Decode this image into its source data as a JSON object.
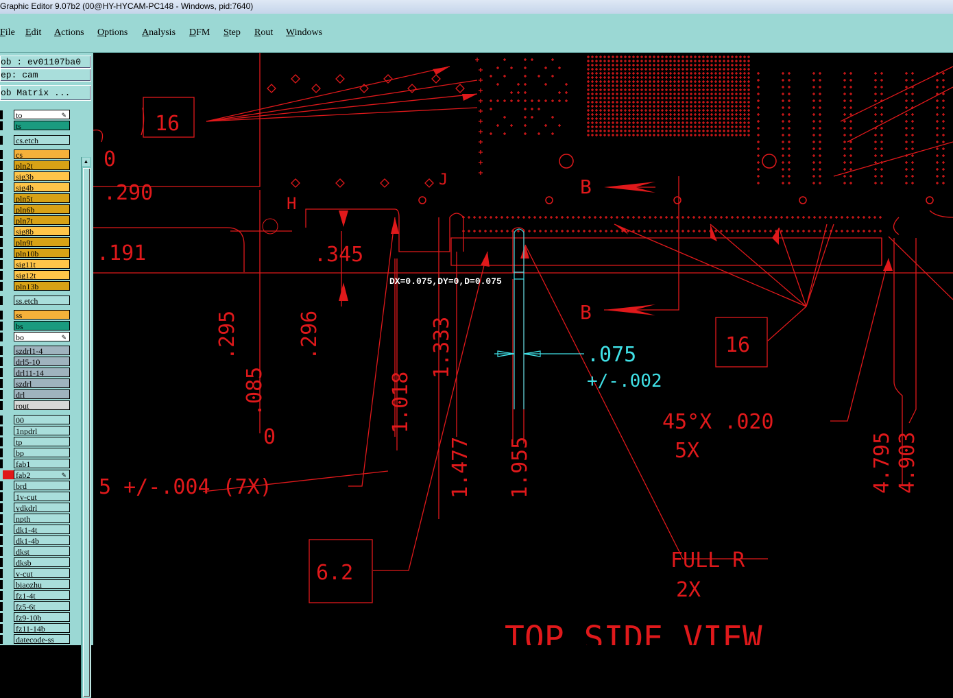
{
  "window": {
    "title": "Graphic Editor 9.07b2 (00@HY-HYCAM-PC148 - Windows, pid:7640)"
  },
  "menu": [
    "File",
    "Edit",
    "Actions",
    "Options",
    "Analysis",
    "DFM",
    "Step",
    "Rout",
    "Windows"
  ],
  "job_info": {
    "job": "ob : ev01107ba0",
    "step": "ep: cam",
    "matrix_button": "ob Matrix ..."
  },
  "layers": [
    {
      "name": "to",
      "color": "#ffffff",
      "edit": true
    },
    {
      "name": "ts",
      "color": "#1a9b7f"
    },
    {
      "name": "cs.etch",
      "color": "#a9dedb"
    },
    {
      "name": "cs",
      "color": "#f5b13a"
    },
    {
      "name": "pln2t",
      "color": "#d8a216"
    },
    {
      "name": "sig3b",
      "color": "#ffc549"
    },
    {
      "name": "sig4b",
      "color": "#ffc549"
    },
    {
      "name": "pln5t",
      "color": "#d8a216"
    },
    {
      "name": "pln6b",
      "color": "#d8a216"
    },
    {
      "name": "pln7t",
      "color": "#d8a216"
    },
    {
      "name": "sig8b",
      "color": "#ffc549"
    },
    {
      "name": "pln9t",
      "color": "#d8a216"
    },
    {
      "name": "pln10b",
      "color": "#d8a216"
    },
    {
      "name": "sig11t",
      "color": "#ffc549"
    },
    {
      "name": "sig12t",
      "color": "#ffc549"
    },
    {
      "name": "pln13b",
      "color": "#d8a216"
    },
    {
      "name": "ss.etch",
      "color": "#a9dedb"
    },
    {
      "name": "ss",
      "color": "#f5b13a"
    },
    {
      "name": "bs",
      "color": "#1a9b7f"
    },
    {
      "name": "bo",
      "color": "#ffffff",
      "edit": true
    },
    {
      "name": "szdrl1-4",
      "color": "#9fb3be"
    },
    {
      "name": "drl5-10",
      "color": "#9fb3be"
    },
    {
      "name": "drl11-14",
      "color": "#9fb3be"
    },
    {
      "name": "szdrl",
      "color": "#9fb3be"
    },
    {
      "name": "drl",
      "color": "#9fb3be"
    },
    {
      "name": "rout",
      "color": "#d7d7d7"
    },
    {
      "name": "00",
      "color": "#a9dedb"
    },
    {
      "name": "1npdrl",
      "color": "#a9dedb"
    },
    {
      "name": "tp",
      "color": "#a9dedb"
    },
    {
      "name": "bp",
      "color": "#a9dedb"
    },
    {
      "name": "fab1",
      "color": "#a9dedb"
    },
    {
      "name": "fab2",
      "color": "#a9dedb",
      "edit": true,
      "active": true
    },
    {
      "name": "brd",
      "color": "#a9dedb"
    },
    {
      "name": "1v-cut",
      "color": "#a9dedb"
    },
    {
      "name": "ydkdrl",
      "color": "#a9dedb"
    },
    {
      "name": "npth",
      "color": "#a9dedb"
    },
    {
      "name": "dk1-4t",
      "color": "#a9dedb"
    },
    {
      "name": "dk1-4b",
      "color": "#a9dedb"
    },
    {
      "name": "dkst",
      "color": "#a9dedb"
    },
    {
      "name": "dksb",
      "color": "#a9dedb"
    },
    {
      "name": "v-cut",
      "color": "#a9dedb"
    },
    {
      "name": "biaozhu",
      "color": "#a9dedb"
    },
    {
      "name": "fz1-4t",
      "color": "#a9dedb"
    },
    {
      "name": "fz5-6t",
      "color": "#a9dedb"
    },
    {
      "name": "fz9-10b",
      "color": "#a9dedb"
    },
    {
      "name": "fz11-14b",
      "color": "#a9dedb"
    },
    {
      "name": "datecode-ss",
      "color": "#a9dedb"
    }
  ],
  "canvas": {
    "measure_readout": "DX=0.075,DY=0,D=0.075",
    "dim_labels": {
      "d290": ".290",
      "d191": ".191",
      "d345": ".345",
      "d295": ".295",
      "d085": ".085",
      "d296": ".296",
      "d1018": "1.018",
      "d1333": "1.333",
      "d1477": "1.477",
      "d1955": "1.955",
      "d4795": "4.795",
      "d4903": "4.903",
      "zero": "0",
      "zero_top": "0",
      "tol": "5 +/-.004 (7X)",
      "chamfer": "45°X .020",
      "chamfer_qty": "5X",
      "fullr": "FULL R",
      "fullr_qty": "2X",
      "view": "TOP SIDE VIEW",
      "box16a": "16",
      "box16b": "16",
      "box62": "6.2",
      "B1": "B",
      "B2": "B",
      "H": "H",
      "J": "J"
    },
    "cyan_dim": {
      "value": ".075",
      "tol": "+/-.002"
    }
  }
}
